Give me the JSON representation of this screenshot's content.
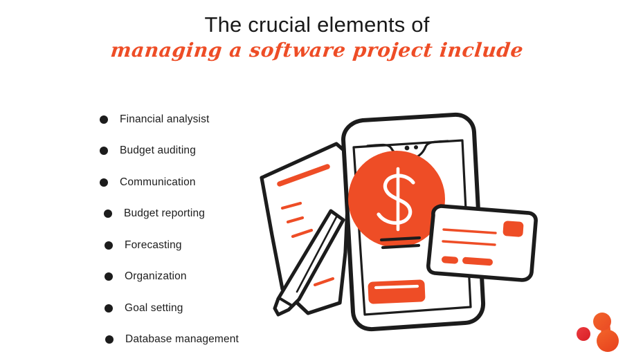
{
  "heading": {
    "line1": "The crucial elements of",
    "line2": "managing a software project include"
  },
  "list": {
    "items": [
      {
        "label": "Financial analysist",
        "indent": 0
      },
      {
        "label": "Budget auditing",
        "indent": 0
      },
      {
        "label": "Communication",
        "indent": 0
      },
      {
        "label": "Budget reporting",
        "indent": 6
      },
      {
        "label": "Forecasting",
        "indent": 7
      },
      {
        "label": "Organization",
        "indent": 7
      },
      {
        "label": "Goal setting",
        "indent": 7
      },
      {
        "label": "Database management",
        "indent": 8
      }
    ]
  },
  "illustration": {
    "name": "finance-mobile-payment-illustration",
    "parts": [
      "document-paper",
      "pencil",
      "smartphone",
      "dollar-circle",
      "credit-card"
    ],
    "symbol": "$"
  },
  "logo": {
    "name": "brand-logo",
    "shape": "two-connected-circles-with-dot"
  },
  "colors": {
    "accent_orange": "#ee4d26",
    "logo_red": "#e8262c",
    "ink_black": "#1c1c1c",
    "background": "#ffffff"
  }
}
